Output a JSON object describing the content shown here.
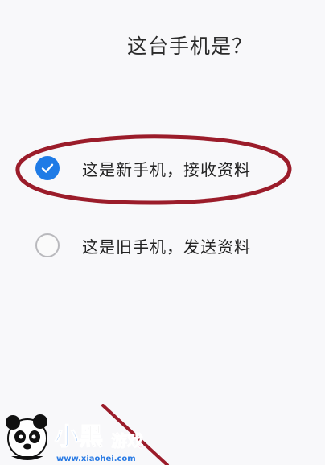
{
  "screen": {
    "title": "这台手机是？"
  },
  "options": [
    {
      "label": "这是新手机，接收资料",
      "checked": true
    },
    {
      "label": "这是旧手机，发送资料",
      "checked": false
    }
  ],
  "annotation": {
    "shape": "ellipse",
    "color": "#9b1c2a",
    "target": "option-new"
  },
  "watermark": {
    "brand": "小黑游戏",
    "url": "www.xiaohei.com"
  },
  "colors": {
    "accent": "#1f7be6",
    "radio_border": "#b9b9bd",
    "annotation": "#9b1c2a",
    "text": "#222222"
  },
  "icons": {
    "check": "checkmark-icon"
  }
}
